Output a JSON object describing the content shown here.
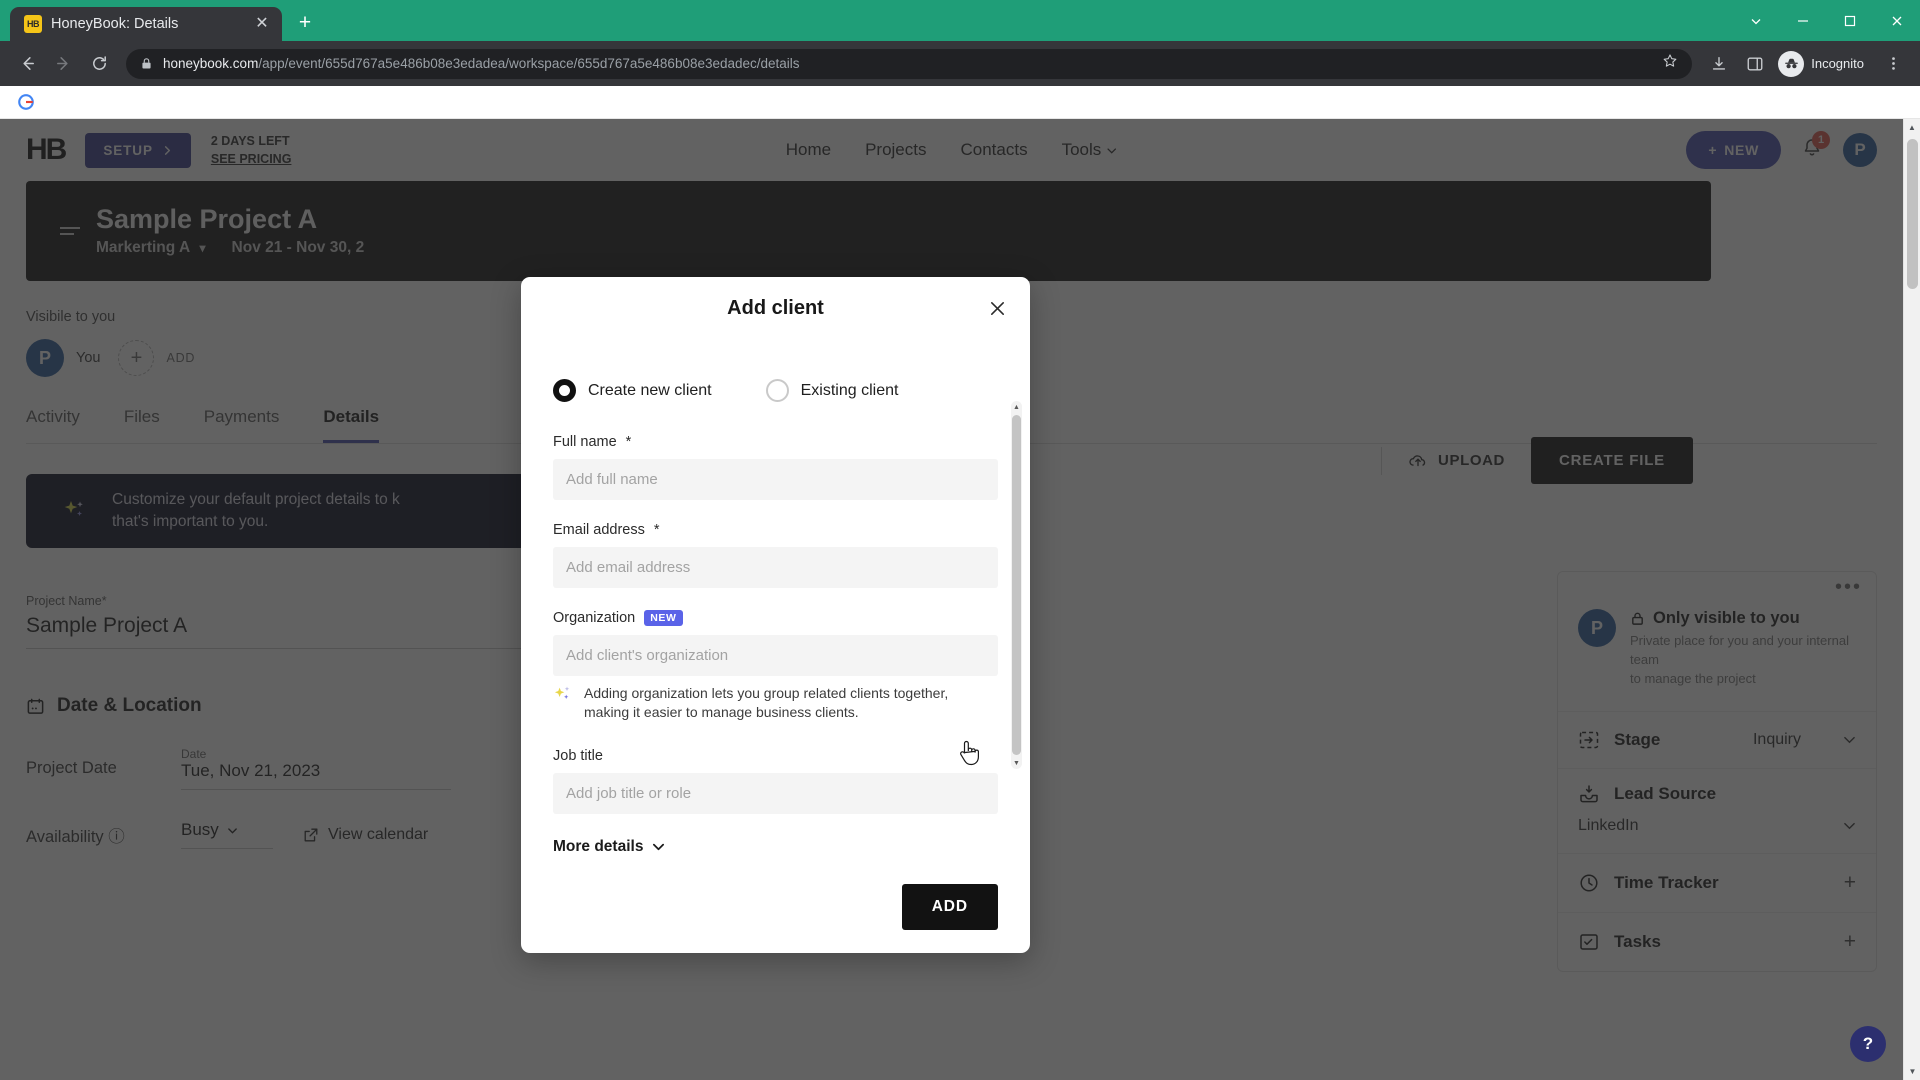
{
  "browser": {
    "tab": {
      "title": "HoneyBook: Details",
      "favicon_label": "HB",
      "close_icon": "close-icon"
    },
    "new_tab_label": "+",
    "window_controls": {
      "minimize": "–",
      "maximize": "□",
      "close": "✕",
      "chevron": "⌄"
    },
    "omnibox": {
      "host": "honeybook.com",
      "path": "/app/event/655d767a5e486b08e3edadea/workspace/655d767a5e486b08e3edadec/details",
      "lock_icon": "lock-icon",
      "star_icon": "bookmark-star-icon"
    },
    "profile": {
      "label": "Incognito",
      "icon": "incognito-icon"
    },
    "nav_icons": {
      "back": "back-arrow-icon",
      "forward": "forward-arrow-icon",
      "reload": "reload-icon",
      "download": "download-icon",
      "sidepanel": "side-panel-icon",
      "menu": "three-dot-menu-icon"
    },
    "bookmark": {
      "icon": "google-g-icon"
    }
  },
  "app": {
    "logo": "HB",
    "setup_button": "SETUP",
    "trial_line1": "2 DAYS LEFT",
    "trial_line2": "SEE PRICING",
    "menu": [
      {
        "label": "Home"
      },
      {
        "label": "Projects"
      },
      {
        "label": "Contacts"
      },
      {
        "label": "Tools"
      }
    ],
    "new_button": "NEW",
    "notification_count": "1",
    "avatar_initial": "P"
  },
  "hero": {
    "title": "Sample Project A",
    "subtitle": "Markerting A",
    "date_range": "Nov 21 - Nov 30, 2"
  },
  "visible": {
    "label": "Visibile to you",
    "person_name": "You",
    "person_initial": "P",
    "add_label": "ADD"
  },
  "tabs": [
    {
      "label": "Activity",
      "active": false
    },
    {
      "label": "Files",
      "active": false
    },
    {
      "label": "Payments",
      "active": false
    },
    {
      "label": "Details",
      "active": true
    }
  ],
  "actions": {
    "upload": "UPLOAD",
    "create_file": "CREATE FILE"
  },
  "banner": {
    "line1": "Customize your default project details to k",
    "line2": "that's important to you."
  },
  "details": {
    "project_name_label": "Project Name*",
    "project_name_value": "Sample Project A",
    "section_title": "Date & Location",
    "project_date_label": "Project Date",
    "date_caption": "Date",
    "date_value": "Tue, Nov 21, 2023",
    "availability_label": "Availability",
    "availability_value": "Busy",
    "view_calendar": "View calendar"
  },
  "rail": {
    "dots": "•••",
    "private_title": "Only visible to you",
    "private_sub_line1": "Private place for you and your internal team",
    "private_sub_line2": "to manage the project",
    "stage_label": "Stage",
    "stage_value": "Inquiry",
    "lead_source_label": "Lead Source",
    "lead_source_value": "LinkedIn",
    "time_tracker_label": "Time Tracker",
    "tasks_label": "Tasks",
    "avatar_initial": "P"
  },
  "modal": {
    "title": "Add client",
    "close_icon": "close-icon",
    "options": [
      {
        "label": "Create new client",
        "selected": true
      },
      {
        "label": "Existing client",
        "selected": false
      }
    ],
    "fields": [
      {
        "label": "Full name",
        "required_mark": "*",
        "placeholder": "Add full name",
        "value": ""
      },
      {
        "label": "Email address",
        "required_mark": "*",
        "placeholder": "Add email address",
        "value": ""
      },
      {
        "label": "Organization",
        "badge": "NEW",
        "placeholder": "Add client's organization",
        "value": ""
      },
      {
        "label": "Job title",
        "placeholder": "Add job title or role",
        "value": ""
      }
    ],
    "hint_line1": "Adding organization lets you group related clients together,",
    "hint_line2": "making it easier to manage business clients.",
    "more_details": "More details",
    "submit_button": "ADD"
  },
  "help": {
    "label": "?"
  },
  "colors": {
    "browser_green": "#1f9e78",
    "chrome_dark": "#35363a",
    "omnibox_dark": "#202124",
    "accent_indigo": "#4a4fb0",
    "badge_new_blue": "#5a63e8",
    "avatar_blue": "#2e5f9e",
    "notification_red": "#e2574c",
    "modal_field_bg": "#f4f4f4",
    "dark_button": "#121212"
  }
}
